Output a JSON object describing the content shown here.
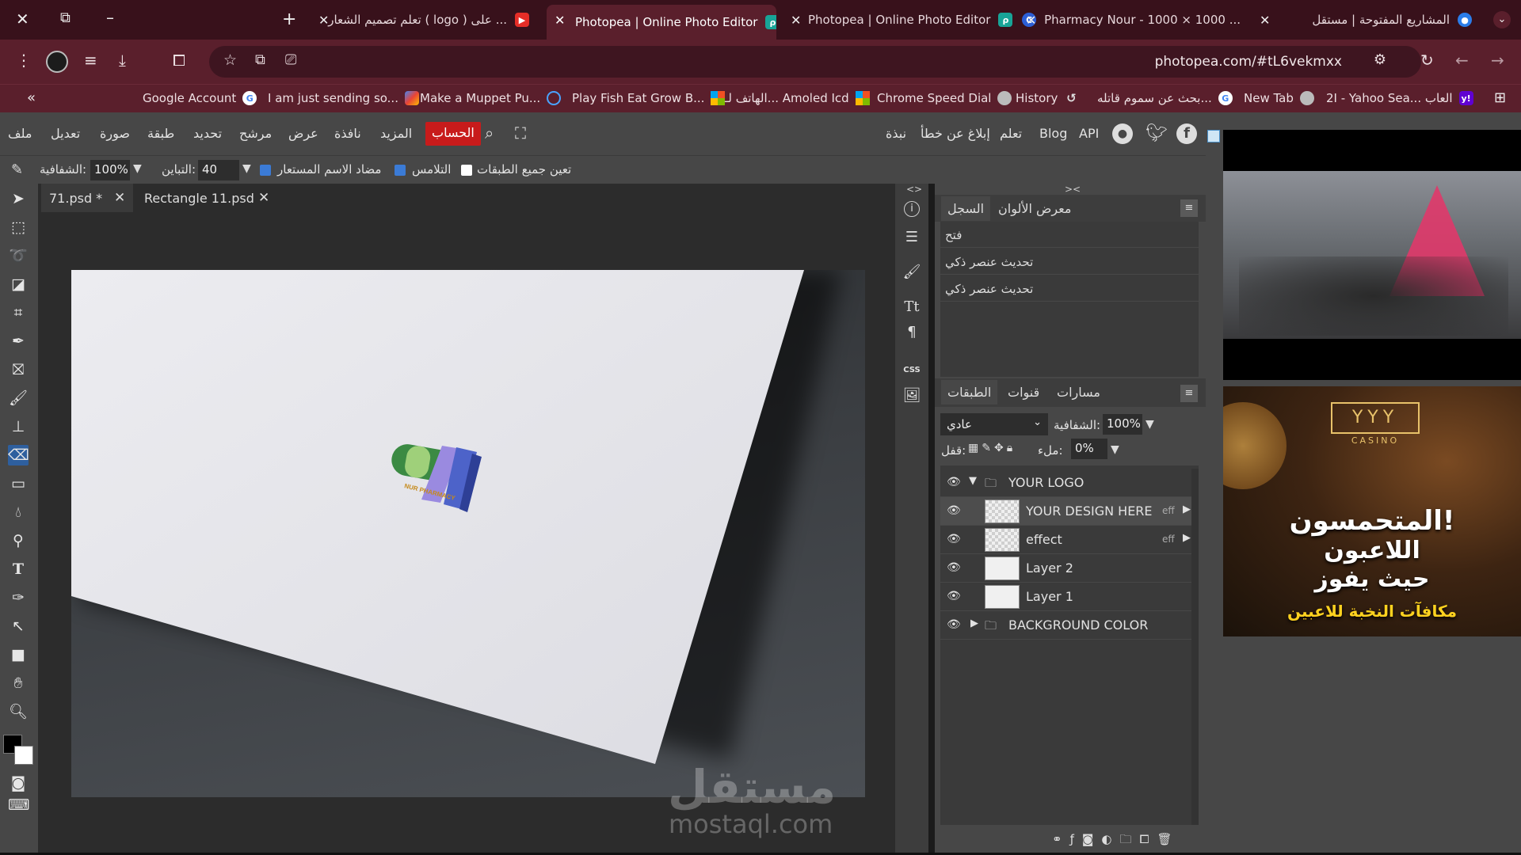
{
  "browser": {
    "tabs": [
      {
        "title": "المشاريع المفتوحة | مستقل",
        "favicon": "mostaql-icon",
        "active": false
      },
      {
        "title": "Pharmacy Nour - 1000 × 1000 ...",
        "favicon": "copilot-icon",
        "active": false
      },
      {
        "title": "Photopea | Online Photo Editor",
        "favicon": "photopea-icon",
        "active": false
      },
      {
        "title": "Photopea | Online Photo Editor",
        "favicon": "photopea-icon",
        "active": true
      },
      {
        "title": "تعلم تصميم الشعار ( logo ) على ...",
        "favicon": "youtube-icon",
        "active": false
      }
    ],
    "new_tab_label": "+",
    "url": "photopea.com/#tL6vekmxx",
    "bookmarks": [
      {
        "label": "2I - Yahoo Sea... العاب",
        "icon": "yahoo-icon"
      },
      {
        "label": "New Tab",
        "icon": "chrome-icon"
      },
      {
        "label": "بحث عن سموم قاتله...",
        "icon": "google-icon"
      },
      {
        "label": "History",
        "icon": "history-icon"
      },
      {
        "label": "Chrome Speed Dial",
        "icon": "chrome-icon"
      },
      {
        "label": "الهاتف لـ... Amoled Icd",
        "icon": "microsoft-icon"
      },
      {
        "label": "Play Fish Eat Grow B...",
        "icon": "microsoft-icon"
      },
      {
        "label": "Make a Muppet Pu...",
        "icon": "loading-icon"
      },
      {
        "label": "I am just sending so...",
        "icon": "gemini-icon"
      },
      {
        "label": "Google Account",
        "icon": "google-icon"
      }
    ],
    "bookmarks_overflow": "«"
  },
  "photopea": {
    "menu_left": [
      "ملف",
      "تعديل",
      "صورة",
      "طبقة",
      "تحديد",
      "مرشح",
      "عرض",
      "نافذة",
      "المزيد"
    ],
    "account_label": "الحساب",
    "menu_right": [
      "نبذة",
      "إبلاغ عن خطأ",
      "تعلم",
      "Blog",
      "API"
    ],
    "options": {
      "opacity_label": "الشفافية:",
      "opacity_value": "100%",
      "tolerance_label": "التباين:",
      "tolerance_value": "40",
      "antialias_label": "مضاد الاسم المستعار",
      "contiguous_label": "التلامس",
      "all_layers_label": "تعين جميع الطبقات"
    },
    "document_tabs": [
      {
        "name": "71.psd *",
        "active": true
      },
      {
        "name": "Rectangle 11.psd",
        "active": false
      }
    ],
    "history_panel": {
      "tabs": [
        "السجل",
        "معرض الألوان"
      ],
      "items": [
        "فتح",
        "تحديث عنصر ذكي",
        "تحديث عنصر ذكي"
      ]
    },
    "layers_panel": {
      "tabs": [
        "الطبقات",
        "قنوات",
        "مسارات"
      ],
      "blend_mode": "عادي",
      "opacity_label": "الشفافية:",
      "opacity_value": "100%",
      "lock_label": "قفل:",
      "fill_label": "ملء:",
      "fill_value": "0%",
      "layers": [
        {
          "name": "YOUR LOGO",
          "type": "group",
          "expanded": true
        },
        {
          "name": "YOUR DESIGN HERE",
          "type": "smart",
          "fx": "eff"
        },
        {
          "name": "effect",
          "type": "smart",
          "fx": "eff"
        },
        {
          "name": "Layer 2",
          "type": "layer"
        },
        {
          "name": "Layer 1",
          "type": "layer"
        },
        {
          "name": "BACKGROUND COLOR",
          "type": "group",
          "expanded": false
        }
      ]
    },
    "canvas": {
      "logo_text": "NUR PHARMACY",
      "watermark_arabic": "مستقل",
      "watermark_latin": "mostaql.com"
    },
    "sidestrip_css_label": "CSS"
  },
  "ads": {
    "casino_brand": "CASINO",
    "casino_line1": "المتحمسون!",
    "casino_line2": "اللاعبون",
    "casino_line3": "حيث يفوز",
    "casino_line4": "مكافآت النخبة للاعبين",
    "colors": {
      "casino_gold": "#e8c26a",
      "casino_yellow": "#ffd21f"
    }
  },
  "colors": {
    "photopea_panel": "#474747",
    "tab_bar": "#38111b",
    "account_red": "#c81b1b"
  }
}
